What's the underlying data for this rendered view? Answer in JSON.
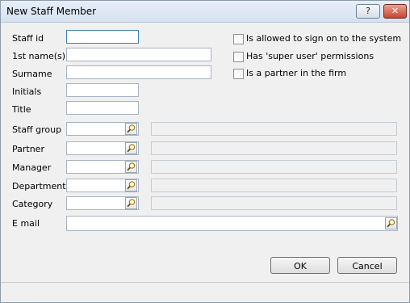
{
  "window": {
    "title": "New Staff Member",
    "help_label": "?",
    "close_label": "✕"
  },
  "form": {
    "staff_id_label": "Staff id",
    "first_names_label": "1st name(s)",
    "surname_label": "Surname",
    "initials_label": "Initials",
    "title_label": "Title",
    "staff_group_label": "Staff group",
    "partner_label": "Partner",
    "manager_label": "Manager",
    "department_label": "Department",
    "category_label": "Category",
    "email_label": "E mail"
  },
  "options": {
    "allowed_sign_on": {
      "label": "Is allowed to sign on to the system",
      "checked": false
    },
    "super_user": {
      "label": "Has 'super user' permissions",
      "checked": false
    },
    "partner_in_firm": {
      "label": "Is a partner in the firm",
      "checked": false
    }
  },
  "buttons": {
    "ok": "OK",
    "cancel": "Cancel"
  },
  "icons": {
    "lookup": "magnifier-icon"
  }
}
